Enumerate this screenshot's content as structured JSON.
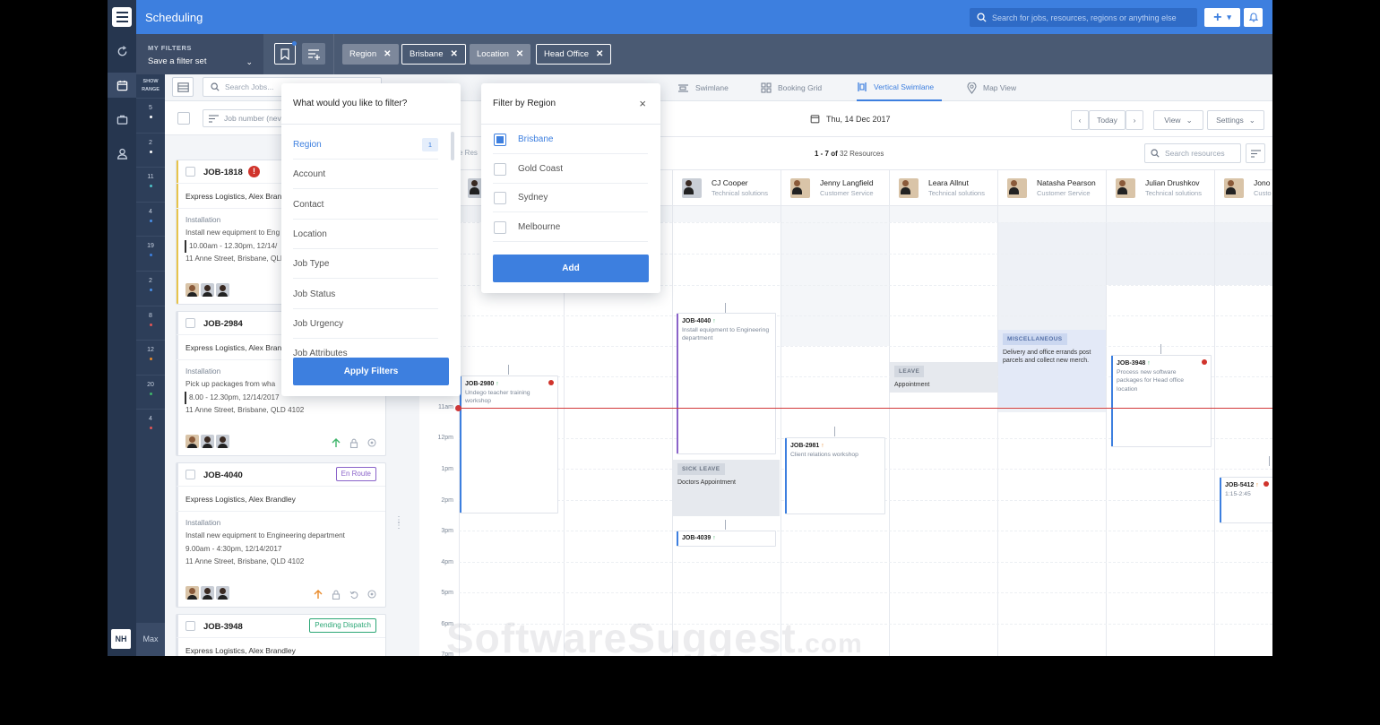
{
  "app": {
    "title": "Scheduling"
  },
  "topbar": {
    "search_placeholder": "Search for jobs, resources, regions or anything else",
    "add_label": "+"
  },
  "rail": {
    "avatar_initials": "NH"
  },
  "range": {
    "head_line1": "SHOW",
    "head_line2": "RANGE",
    "cells": [
      {
        "value": "5",
        "dot": "#ffffff"
      },
      {
        "value": "2",
        "dot": "#ffffff"
      },
      {
        "value": "11",
        "dot": "#4fc1c7"
      },
      {
        "value": "4",
        "dot": "#4a8fe7"
      },
      {
        "value": "19",
        "dot": "#3d7fdf"
      },
      {
        "value": "2",
        "dot": "#4a8fe7"
      },
      {
        "value": "8",
        "dot": "#e25555"
      },
      {
        "value": "12",
        "dot": "#e98b2b"
      },
      {
        "value": "20",
        "dot": "#3fb56b"
      },
      {
        "value": "4",
        "dot": "#e25555"
      }
    ],
    "max_label": "Max"
  },
  "filterbar": {
    "my_filters_label": "MY FILTERS",
    "filter_set_value": "Save a filter set",
    "chips": [
      {
        "key": "Region",
        "value": "Brisbane"
      },
      {
        "key": "Location",
        "value": "Head Office"
      }
    ]
  },
  "toolbar": {
    "search_placeholder": "Search Jobs...",
    "tabs": [
      {
        "label": "Swimlane",
        "icon": "swimlane-icon"
      },
      {
        "label": "Booking Grid",
        "icon": "booking-grid-icon"
      },
      {
        "label": "Vertical Swimlane",
        "icon": "vertical-swimlane-icon",
        "active": true
      },
      {
        "label": "Map View",
        "icon": "map-pin-icon"
      }
    ]
  },
  "joblist": {
    "sort_label": "Job number (nev",
    "jobs": [
      {
        "id": "JOB-1818",
        "alert": "!",
        "client": "Express Logistics, Alex Bran",
        "type": "Installation",
        "desc": "Install new equipment to Eng",
        "time": "10.00am - 12.30pm, 12/14/",
        "address": "11 Anne Street, Brisbane, QLD",
        "accent": "#e8c44a"
      },
      {
        "id": "JOB-2984",
        "client": "Express Logistics, Alex Bran",
        "type": "Installation",
        "desc": "Pick up packages from wha",
        "time": "8.00 - 12.30pm, 12/14/2017",
        "address": "11 Anne Street, Brisbane, QLD 4102",
        "accent": "#dfe3ea"
      },
      {
        "id": "JOB-4040",
        "status": "En Route",
        "status_color": "#8a63c9",
        "client": "Express Logistics, Alex Brandley",
        "type": "Installation",
        "desc": "Install new equipment to Engineering department",
        "time": "9.00am - 4:30pm, 12/14/2017",
        "address": "11 Anne Street, Brisbane, QLD 4102",
        "accent": "#dfe3ea"
      },
      {
        "id": "JOB-3948",
        "status": "Pending Dispatch",
        "status_color": "#2ca776",
        "client": "Express Logistics, Alex Brandley"
      }
    ]
  },
  "calendar": {
    "date": "Thu, 14 Dec 2017",
    "today_label": "Today",
    "view_label": "View",
    "settings_label": "Settings",
    "resource_range": "1 - 7 of",
    "resource_total": "32 Resources",
    "resource_search_placeholder": "Search resources",
    "partial_label": "e Res",
    "resources": [
      {
        "name": "CJ Cooper",
        "role": "Technical solutions"
      },
      {
        "name": "Jenny Langfield",
        "role": "Customer Service"
      },
      {
        "name": "Leara Allnut",
        "role": "Technical solutions"
      },
      {
        "name": "Natasha Pearson",
        "role": "Customer Service"
      },
      {
        "name": "Julian Drushkov",
        "role": "Technical solutions"
      },
      {
        "name": "Jono",
        "role": "Custo"
      }
    ],
    "time_labels": [
      "11am",
      "12pm",
      "1pm",
      "2pm",
      "3pm",
      "4pm",
      "5pm",
      "6pm",
      "7pm"
    ],
    "events": {
      "e2980": {
        "id": "JOB-2980",
        "arrow": "↑",
        "desc1": "Undego teacher training",
        "desc2": "workshop"
      },
      "e4040": {
        "id": "JOB-4040",
        "arrow": "↑",
        "desc1": "Install equipment to Engineering",
        "desc2": "department"
      },
      "e4039": {
        "id": "JOB-4039",
        "arrow": "↑"
      },
      "e2981": {
        "id": "JOB-2981",
        "arrow": "↑",
        "desc1": "Client relations workshop"
      },
      "e3948": {
        "id": "JOB-3948",
        "arrow": "↑",
        "desc1": "Process new software",
        "desc2": "packages for Head office",
        "desc3": "location"
      },
      "e5412": {
        "id": "JOB-5412",
        "arrow": "↑",
        "desc1": "1:15-2:45"
      }
    },
    "blocks": {
      "sick": {
        "tag": "SICK LEAVE",
        "text": "Doctors Appointment"
      },
      "leave": {
        "tag": "LEAVE",
        "text": "Appointment"
      },
      "misc": {
        "tag": "MISCELLANEOUS",
        "text1": "Delivery and office errands post",
        "text2": "parcels and collect new merch."
      }
    }
  },
  "filter_popover": {
    "title": "What would you like to filter?",
    "items": [
      {
        "label": "Region",
        "count": "1",
        "selected": true
      },
      {
        "label": "Account"
      },
      {
        "label": "Contact"
      },
      {
        "label": "Location"
      },
      {
        "label": "Job Type"
      },
      {
        "label": "Job Status"
      },
      {
        "label": "Job Urgency"
      },
      {
        "label": "Job Attributes"
      }
    ],
    "apply_label": "Apply Filters"
  },
  "region_popover": {
    "title": "Filter by Region",
    "close": "×",
    "options": [
      {
        "label": "Brisbane",
        "checked": true
      },
      {
        "label": "Gold Coast"
      },
      {
        "label": "Sydney"
      },
      {
        "label": "Melbourne"
      }
    ],
    "add_label": "Add"
  },
  "watermark": {
    "main": "SoftwareSuggest",
    "suffix": ".com"
  }
}
